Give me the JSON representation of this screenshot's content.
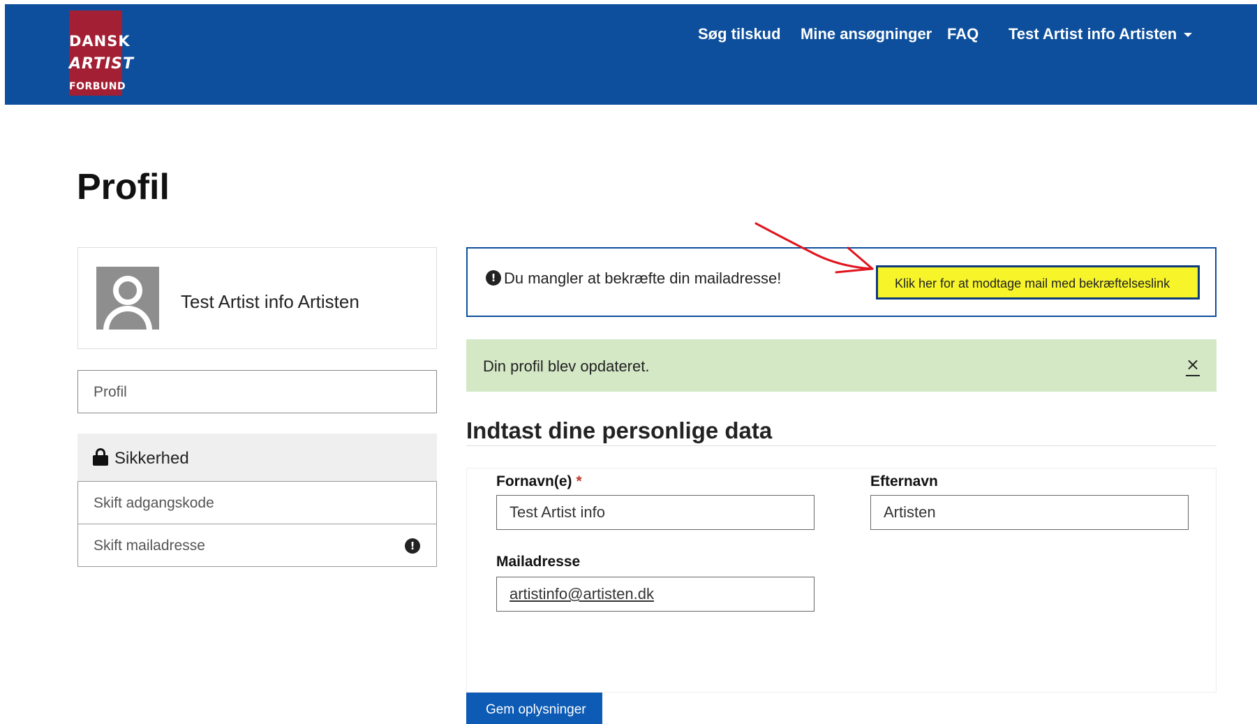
{
  "header": {
    "logo": {
      "line1": "DANSK",
      "line2": "ARTIST",
      "line3": "FORBUND"
    },
    "nav": {
      "search_grants": "Søg tilskud",
      "my_applications": "Mine ansøgninger",
      "faq": "FAQ",
      "user_menu": "Test Artist info Artisten"
    }
  },
  "page": {
    "title": "Profil"
  },
  "sidebar": {
    "profile_name": "Test Artist info Artisten",
    "profile_link": "Profil",
    "security": {
      "heading": "Sikkerhed",
      "items": [
        {
          "label": "Skift adgangskode"
        },
        {
          "label": "Skift mailadresse"
        }
      ]
    }
  },
  "alerts": {
    "verify": {
      "message": "Du mangler at bekræfte din mailadresse!",
      "link_label": "Klik her for at modtage mail med bekræftelseslink"
    },
    "success": {
      "message": "Din profil blev opdateret.",
      "close_glyph": "×"
    }
  },
  "form": {
    "section_title": "Indtast dine personlige data",
    "first_name_label": "Fornavn(e)",
    "required_mark": "*",
    "first_name_value": "Test Artist info",
    "last_name_label": "Efternavn",
    "last_name_value": "Artisten",
    "email_label": "Mailadresse",
    "email_value": "artistinfo@artisten.dk",
    "save_label": "Gem oplysninger"
  },
  "icons": {
    "lock": "lock-icon",
    "warning": "exclamation-circle-icon",
    "avatar": "user-placeholder-icon",
    "close": "close-icon",
    "caret": "caret-down-icon"
  },
  "colors": {
    "navbar": "#0d4f9c",
    "logo": "#a31f34",
    "success_bg": "#d4e8c6",
    "highlight": "#f7f52a",
    "annotation_arrow": "#e0141e",
    "primary_button": "#0d5bb5"
  }
}
